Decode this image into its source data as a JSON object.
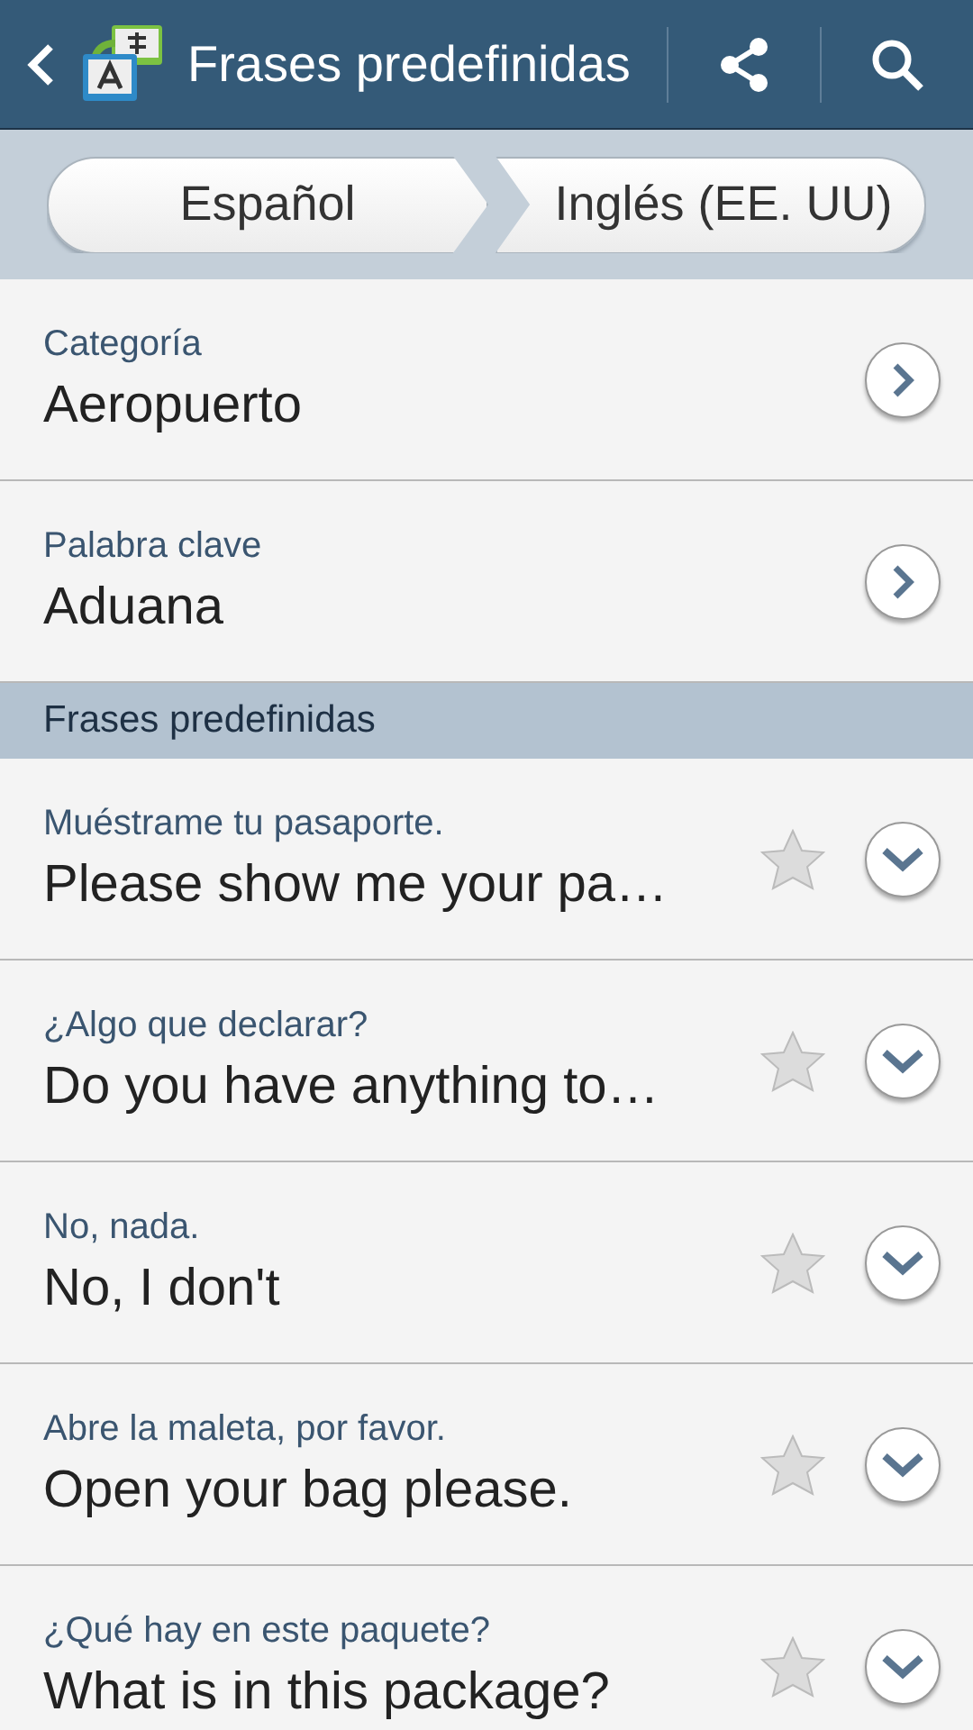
{
  "header": {
    "title": "Frases predefinidas"
  },
  "languages": {
    "source": "Español",
    "target": "Inglés (EE. UU)"
  },
  "filters": [
    {
      "label": "Categoría",
      "value": "Aeropuerto"
    },
    {
      "label": "Palabra clave",
      "value": "Aduana"
    }
  ],
  "section": {
    "title": "Frases predefinidas"
  },
  "phrases": [
    {
      "source": "Muéstrame tu pasaporte.",
      "translation": "Please show me your pa…",
      "favorite": false
    },
    {
      "source": "¿Algo que declarar?",
      "translation": "Do you have anything to…",
      "favorite": false
    },
    {
      "source": "No, nada.",
      "translation": "No, I don't",
      "favorite": false
    },
    {
      "source": "Abre la maleta, por favor.",
      "translation": "Open your bag please.",
      "favorite": false
    },
    {
      "source": "¿Qué hay en este paquete?",
      "translation": "What is in this package?",
      "favorite": false
    }
  ]
}
